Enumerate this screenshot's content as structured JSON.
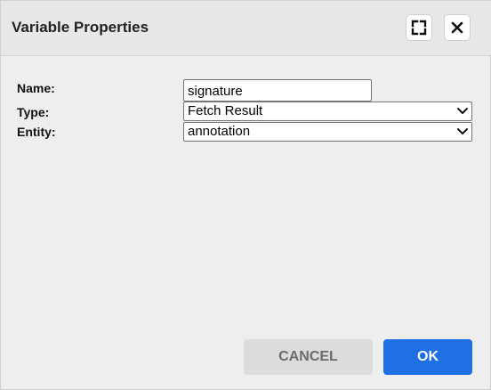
{
  "dialog": {
    "title": "Variable Properties",
    "maximize_icon": "maximize-icon",
    "close_icon": "close-icon"
  },
  "form": {
    "name_label": "Name:",
    "name_value": "signature",
    "type_label": "Type:",
    "type_value": "Fetch Result",
    "entity_label": "Entity:",
    "entity_value": "annotation"
  },
  "buttons": {
    "cancel_label": "CANCEL",
    "ok_label": "OK"
  },
  "colors": {
    "primary": "#1f6fe5",
    "background": "#eeeeee",
    "title_bar": "#e8e8e8"
  }
}
